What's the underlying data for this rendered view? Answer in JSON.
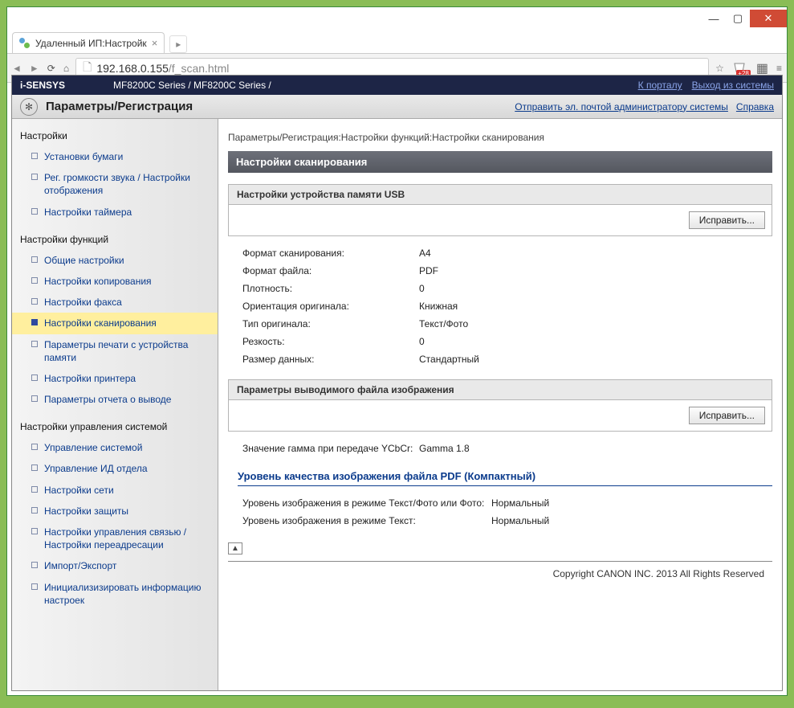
{
  "browser": {
    "tab_title": "Удаленный ИП:Настройк",
    "url_host": "192.168.0.155",
    "url_path": "/f_scan.html",
    "ext_badge": "+28"
  },
  "appbar": {
    "product": "i-SENSYS",
    "device": "MF8200C Series / MF8200C Series /",
    "portal": "К порталу",
    "logout": "Выход из системы"
  },
  "secondbar": {
    "title": "Параметры/Регистрация",
    "mail_admin": "Отправить эл. почтой администратору системы",
    "help": "Справка"
  },
  "sidebar": {
    "groups": [
      {
        "title": "Настройки",
        "items": [
          "Установки бумаги",
          "Рег. громкости звука / Настройки отображения",
          "Настройки таймера"
        ]
      },
      {
        "title": "Настройки функций",
        "items": [
          "Общие настройки",
          "Настройки копирования",
          "Настройки факса",
          "Настройки сканирования",
          "Параметры печати с устройства памяти",
          "Настройки принтера",
          "Параметры отчета о выводе"
        ],
        "active_index": 3
      },
      {
        "title": "Настройки управления системой",
        "items": [
          "Управление системой",
          "Управление ИД отдела",
          "Настройки сети",
          "Настройки защиты",
          "Настройки управления связью / Настройки переадресации",
          "Импорт/Экспорт",
          "Инициализизировать информацию настроек"
        ]
      }
    ]
  },
  "main": {
    "breadcrumb": "Параметры/Регистрация:Настройки функций:Настройки сканирования",
    "page_title": "Настройки сканирования",
    "edit_label": "Исправить...",
    "section1": {
      "title": "Настройки устройства памяти USB",
      "rows": [
        {
          "k": "Формат сканирования:",
          "v": "A4"
        },
        {
          "k": "Формат файла:",
          "v": "PDF"
        },
        {
          "k": "Плотность:",
          "v": "0"
        },
        {
          "k": "Ориентация оригинала:",
          "v": "Книжная"
        },
        {
          "k": "Тип оригинала:",
          "v": "Текст/Фото"
        },
        {
          "k": "Резкость:",
          "v": "0"
        },
        {
          "k": "Размер данных:",
          "v": "Стандартный"
        }
      ]
    },
    "section2": {
      "title": "Параметры выводимого файла изображения",
      "rows": [
        {
          "k": "Значение гамма при передаче YCbCr:",
          "v": "Gamma 1.8"
        }
      ],
      "sub": {
        "title": "Уровень качества изображения файла PDF (Компактный)",
        "rows": [
          {
            "k": "Уровень изображения в режиме Текст/Фото или Фото:",
            "v": "Нормальный"
          },
          {
            "k": "Уровень изображения в режиме Текст:",
            "v": "Нормальный"
          }
        ]
      }
    }
  },
  "footer": "Copyright CANON INC. 2013 All Rights Reserved"
}
